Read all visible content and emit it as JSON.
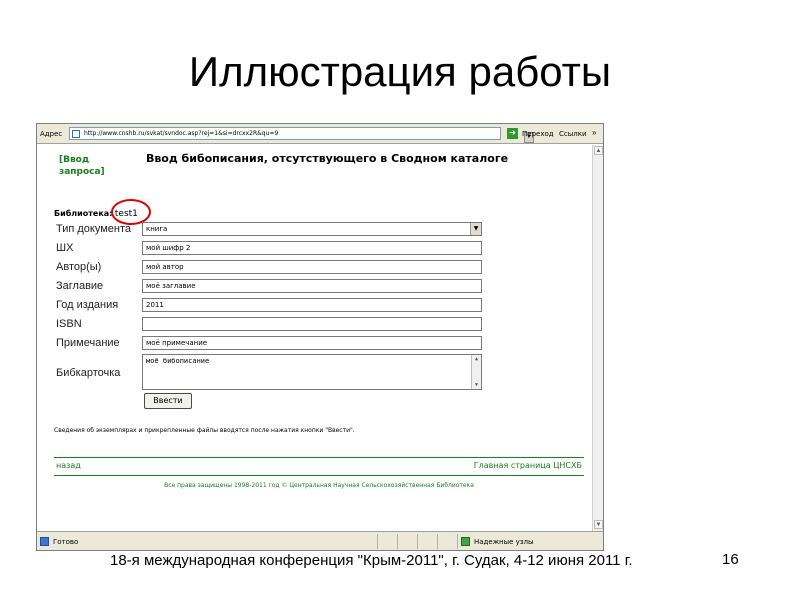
{
  "slide": {
    "title": "Иллюстрация работы",
    "footer": "18-я международная конференция \"Крым-2011\", г. Судак, 4-12 июня 2011 г.",
    "page_number": "16"
  },
  "browser": {
    "address_label": "Адрес",
    "url": "http://www.cnshb.ru/svkat/svndoc.asp?rej=1&si=drcxx2R&qu=9",
    "go_label": "Переход",
    "links_label": "Ссылки",
    "status_text": "Готово",
    "status_zone": "Надежные узлы"
  },
  "page": {
    "back_link_top": "[Ввод запроса]",
    "heading": "Ввод бибописания, отсутствующего в Сводном каталоге",
    "library_label": "Библиотека:",
    "library_value": "test1",
    "fields": [
      {
        "label": "Тип документа",
        "value": "книга"
      },
      {
        "label": "ШХ",
        "value": "мой шифр 2"
      },
      {
        "label": "Автор(ы)",
        "value": "мой автор"
      },
      {
        "label": "Заглавие",
        "value": "моё заглавие"
      },
      {
        "label": "Год издания",
        "value": "2011"
      },
      {
        "label": "ISBN",
        "value": ""
      },
      {
        "label": "Примечание",
        "value": "моё примечание"
      },
      {
        "label": "Бибкарточка",
        "value": "моё бибописание"
      }
    ],
    "submit_label": "Ввести",
    "note": "Сведения об экземплярах и прикрепленные файлы вводятся после нажатия кнопки \"Ввести\".",
    "nav_back": "назад",
    "nav_home": "Главная страница ЦНСХБ",
    "copyright": "Все права защищены 1998-2011 год © Центральная Научная Сельскохозяйственная Библиотека"
  },
  "colors": {
    "link_green": "#17811c",
    "highlight_red": "#e30000"
  },
  "icons": {
    "go": "go-arrow-icon",
    "favicon": "page-favicon-icon",
    "status": "page-status-icon",
    "zone": "trusted-zone-icon"
  }
}
